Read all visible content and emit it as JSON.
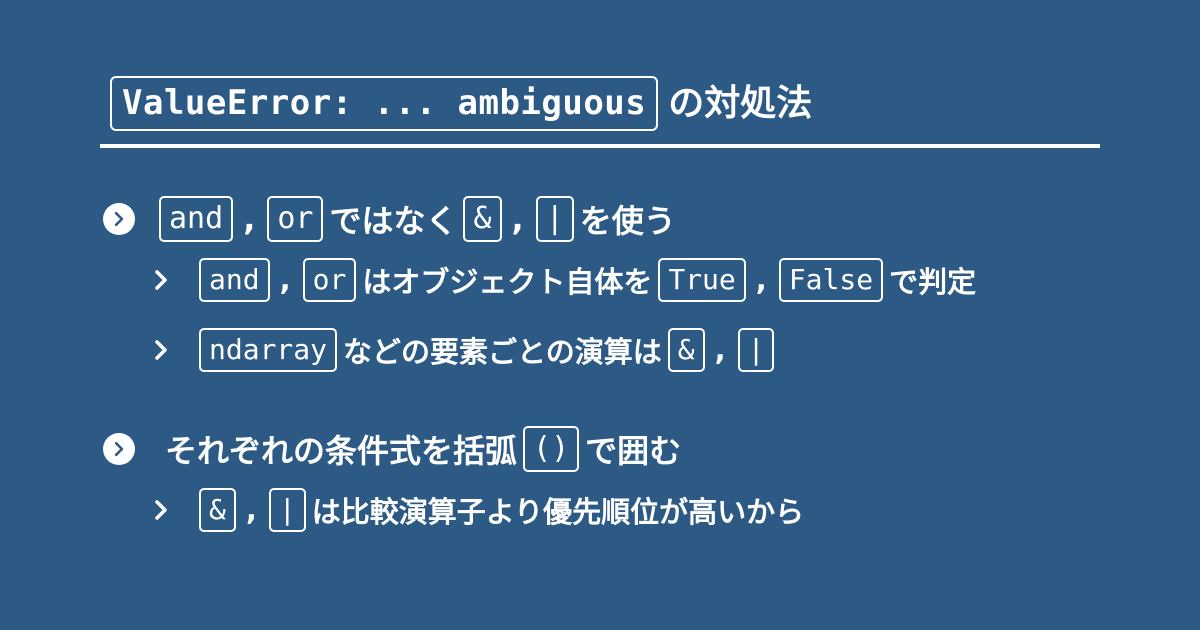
{
  "title": {
    "code": "ValueError: ... ambiguous",
    "suffix": "の対処法"
  },
  "colors": {
    "background": "#2c5a85",
    "foreground": "#ffffff"
  },
  "items": [
    {
      "level": 1,
      "bullet_icon": "circle-chevron-right-icon",
      "parts": [
        {
          "type": "code",
          "text": "and"
        },
        {
          "type": "comma",
          "text": ","
        },
        {
          "type": "code",
          "text": "or"
        },
        {
          "type": "text",
          "text": "ではなく"
        },
        {
          "type": "code",
          "text": "&"
        },
        {
          "type": "comma",
          "text": ","
        },
        {
          "type": "code",
          "text": "|"
        },
        {
          "type": "text",
          "text": "を使う"
        }
      ]
    },
    {
      "level": 2,
      "bullet_icon": "chevron-right-icon",
      "parts": [
        {
          "type": "code",
          "text": "and"
        },
        {
          "type": "comma",
          "text": ","
        },
        {
          "type": "code",
          "text": "or"
        },
        {
          "type": "text",
          "text": "はオブジェクト自体を"
        },
        {
          "type": "code",
          "text": "True"
        },
        {
          "type": "comma",
          "text": ","
        },
        {
          "type": "code",
          "text": "False"
        },
        {
          "type": "text",
          "text": "で判定"
        }
      ]
    },
    {
      "level": 2,
      "bullet_icon": "chevron-right-icon",
      "parts": [
        {
          "type": "code",
          "text": "ndarray"
        },
        {
          "type": "text",
          "text": "などの要素ごとの演算は"
        },
        {
          "type": "code",
          "text": "&"
        },
        {
          "type": "comma",
          "text": ","
        },
        {
          "type": "code",
          "text": "|"
        }
      ]
    },
    {
      "level": 1,
      "bullet_icon": "circle-chevron-right-icon",
      "parts": [
        {
          "type": "text",
          "text": "それぞれの条件式を括弧"
        },
        {
          "type": "code",
          "text": "()"
        },
        {
          "type": "text",
          "text": "で囲む"
        }
      ]
    },
    {
      "level": 2,
      "bullet_icon": "chevron-right-icon",
      "parts": [
        {
          "type": "code",
          "text": "&"
        },
        {
          "type": "comma",
          "text": ","
        },
        {
          "type": "code",
          "text": "|"
        },
        {
          "type": "text",
          "text": "は比較演算子より優先順位が高いから"
        }
      ]
    }
  ]
}
